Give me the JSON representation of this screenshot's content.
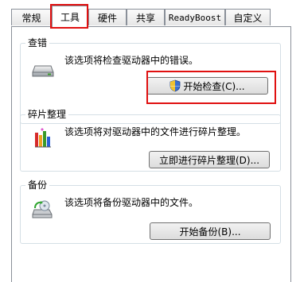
{
  "tabs": [
    {
      "label": "常规"
    },
    {
      "label": "工具"
    },
    {
      "label": "硬件"
    },
    {
      "label": "共享"
    },
    {
      "label": "ReadyBoost"
    },
    {
      "label": "自定义"
    }
  ],
  "active_tab": "工具",
  "groups": {
    "error_check": {
      "title": "查错",
      "description": "该选项将检查驱动器中的错误。",
      "button": "开始检查(C)...",
      "icon": "hard-drive-icon"
    },
    "defrag": {
      "title": "碎片整理",
      "description": "该选项将对驱动器中的文件进行碎片整理。",
      "button": "立即进行碎片整理(D)...",
      "icon": "defrag-icon"
    },
    "backup": {
      "title": "备份",
      "description": "该选项将备份驱动器中的文件。",
      "button": "开始备份(B)...",
      "icon": "backup-icon"
    }
  },
  "colors": {
    "highlight": "#e01010",
    "border": "#8a9099"
  }
}
